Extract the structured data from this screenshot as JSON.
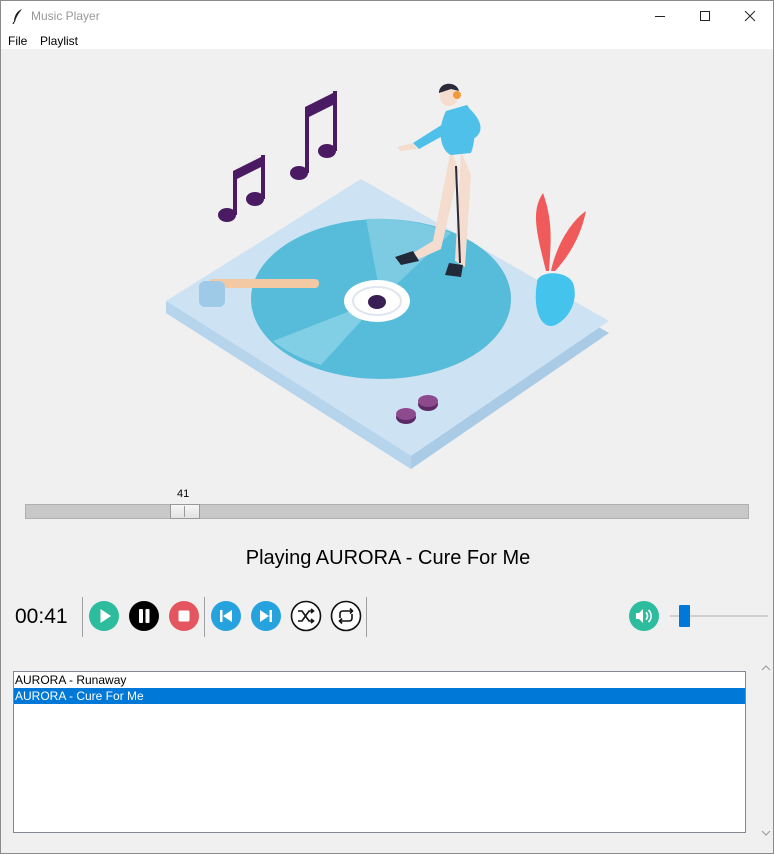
{
  "window": {
    "title": "Music Player"
  },
  "menu": {
    "file": "File",
    "playlist": "Playlist"
  },
  "progress": {
    "value_label": "41",
    "value": 41,
    "max": 240
  },
  "status": {
    "now_playing": "Playing AURORA - Cure For Me"
  },
  "controls": {
    "elapsed": "00:41",
    "buttons": [
      "play-icon",
      "pause-icon",
      "stop-icon",
      "previous-icon",
      "next-icon",
      "shuffle-icon",
      "repeat-icon"
    ]
  },
  "volume": {
    "level": 0.15
  },
  "playlist": {
    "items": [
      "AURORA - Runaway",
      "AURORA - Cure For Me"
    ],
    "selected_index": 1
  },
  "colors": {
    "play": "#2ebc9f",
    "pause": "#000000",
    "stop": "#e4555f",
    "nav": "#26a3df",
    "selection": "#0078d7"
  }
}
